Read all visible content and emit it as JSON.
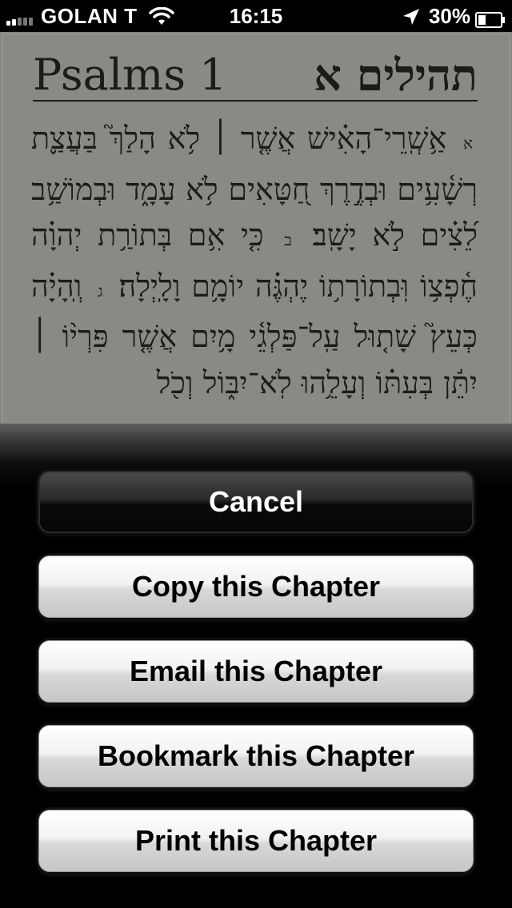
{
  "status_bar": {
    "carrier": "GOLAN T",
    "time": "16:15",
    "battery": "30%",
    "signal_bars": 5,
    "signal_bars_filled": 2,
    "icons": {
      "wifi": "wifi-icon",
      "location": "location-arrow-icon",
      "battery": "battery-icon"
    }
  },
  "page": {
    "title_english": "Psalms 1",
    "title_hebrew": "תהילים א",
    "verses": [
      {
        "num": "א",
        "text": "אַ֥שְֽׁרֵי־הָאִ֗ישׁ אֲשֶׁ֤ר ׀ לֹ֥א הָלַךְ֮ בַּעֲצַ֢ת רְשָׁ֫עִ֥ים וּבְדֶ֣רֶךְ חַ֭טָּאִים לֹ֥א עָמָ֑ד וּבְמוֹשַׁ֥ב לֵ֝צִ֗ים לֹ֣א יָשָֽׁב׃"
      },
      {
        "num": "ב",
        "text": "כִּ֤י אִ֥ם בְּתוֹרַ֥ת יְהוָ֗ה חֶ֫פְצ֥וֹ וּֽבְתוֹרָת֥וֹ יֶהְגֶּ֗ה יוֹמָ֥ם וָלָֽיְלָה׃"
      },
      {
        "num": "ג",
        "text": "וְֽהָיָ֗ה כְּעֵץ֮ שָׁת֤וּל עַֽל־פַּלְגֵ֫י מָ֥יִם אֲשֶׁ֤ר פִּרְי֨וֹ ׀ יִתֵּ֬ן בְּעִתּ֗וֹ וְעָלֵ֥הוּ לֹֽא־יִבּ֑וֹל וְכֹ֖ל"
      }
    ]
  },
  "action_sheet": {
    "cancel_label": "Cancel",
    "copy_label": "Copy this Chapter",
    "email_label": "Email this Chapter",
    "bookmark_label": "Bookmark this Chapter",
    "print_label": "Print this Chapter"
  },
  "colors": {
    "page_background": "#8b8985",
    "ink": "#1c1b18",
    "sheet_background": "#000000",
    "cancel_button": "#1a1a1a",
    "option_button": "#e6e6e6"
  }
}
